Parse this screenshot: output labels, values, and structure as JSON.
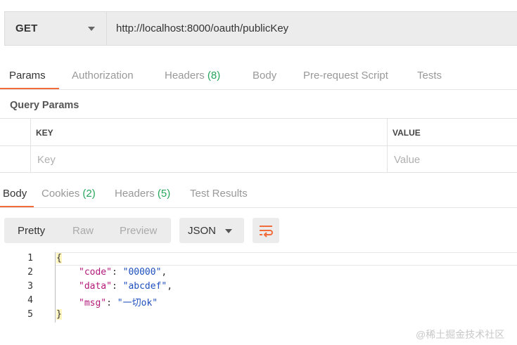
{
  "request": {
    "method": "GET",
    "url": "http://localhost:8000/oauth/publicKey"
  },
  "request_tabs": [
    {
      "label": "Params",
      "count": ""
    },
    {
      "label": "Authorization",
      "count": ""
    },
    {
      "label": "Headers",
      "count": "(8)"
    },
    {
      "label": "Body",
      "count": ""
    },
    {
      "label": "Pre-request Script",
      "count": ""
    },
    {
      "label": "Tests",
      "count": ""
    }
  ],
  "query_params": {
    "title": "Query Params",
    "columns": [
      "KEY",
      "VALUE"
    ],
    "placeholders": {
      "key": "Key",
      "value": "Value"
    }
  },
  "response_tabs": [
    {
      "label": "Body",
      "count": ""
    },
    {
      "label": "Cookies",
      "count": "(2)"
    },
    {
      "label": "Headers",
      "count": "(5)"
    },
    {
      "label": "Test Results",
      "count": ""
    }
  ],
  "body_toolbar": {
    "views": [
      "Pretty",
      "Raw",
      "Preview"
    ],
    "format": "JSON"
  },
  "response_code": {
    "line_numbers": [
      "1",
      "2",
      "3",
      "4",
      "5"
    ],
    "open": "{",
    "close": "}",
    "lines": [
      {
        "key": "\"code\"",
        "value": "\"00000\"",
        "comma": ","
      },
      {
        "key": "\"data\"",
        "value": "\"abcdef\"",
        "comma": ","
      },
      {
        "key": "\"msg\"",
        "value": "\"一切ok\"",
        "comma": ""
      }
    ]
  },
  "colors": {
    "accent": "#f26b3a",
    "count_green": "#26a65b",
    "json_key": "#b4197a",
    "json_string": "#1f4fbf"
  },
  "watermark": "@稀土掘金技术社区"
}
